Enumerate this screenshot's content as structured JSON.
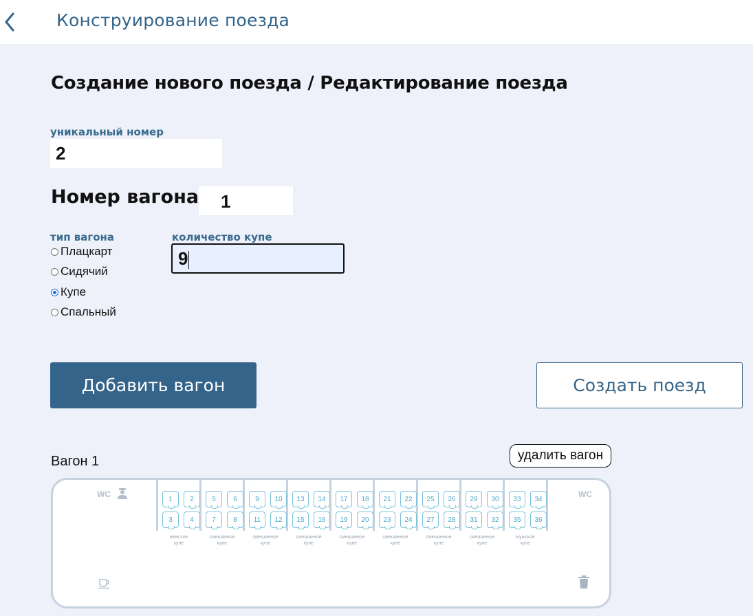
{
  "topbar": {
    "title": "Конструирование поезда"
  },
  "heading": "Создание нового поезда / Редактирование поезда",
  "unique_number": {
    "label": "уникальный номер",
    "value": "2"
  },
  "wagon_number": {
    "label": "Номер вагона:",
    "value": "1"
  },
  "wagon_type": {
    "label": "тип вагона",
    "options": [
      "Плацкарт",
      "Сидячий",
      "Купе",
      "Спальный"
    ],
    "selected": "Купе"
  },
  "compartments": {
    "label": "количество купе",
    "value": "9"
  },
  "buttons": {
    "add_car": "Добавить вагон",
    "create_train": "Создать поезд"
  },
  "car": {
    "title": "Вагон 1",
    "delete_label": "удалить вагон",
    "wc_left": "WC",
    "wc_right": "WC",
    "icons": [
      "conductor-icon",
      "cup-icon",
      "trash-icon"
    ],
    "compartments": [
      {
        "seats": [
          "1",
          "2",
          "3",
          "4"
        ],
        "label_top": "женское",
        "label_bottom": "купе"
      },
      {
        "seats": [
          "5",
          "6",
          "7",
          "8"
        ],
        "label_top": "смешанное",
        "label_bottom": "купе"
      },
      {
        "seats": [
          "9",
          "10",
          "11",
          "12"
        ],
        "label_top": "смешанное",
        "label_bottom": "купе"
      },
      {
        "seats": [
          "13",
          "14",
          "15",
          "16"
        ],
        "label_top": "смешанное",
        "label_bottom": "купе"
      },
      {
        "seats": [
          "17",
          "18",
          "19",
          "20"
        ],
        "label_top": "смешанное",
        "label_bottom": "купе"
      },
      {
        "seats": [
          "21",
          "22",
          "23",
          "24"
        ],
        "label_top": "смешанное",
        "label_bottom": "купе"
      },
      {
        "seats": [
          "25",
          "26",
          "27",
          "28"
        ],
        "label_top": "смешанное",
        "label_bottom": "купе"
      },
      {
        "seats": [
          "29",
          "30",
          "31",
          "32"
        ],
        "label_top": "смешанное",
        "label_bottom": "купе"
      },
      {
        "seats": [
          "33",
          "34",
          "35",
          "36"
        ],
        "label_top": "мужское",
        "label_bottom": "купе"
      }
    ]
  },
  "colors": {
    "primary": "#34648a",
    "background": "#eef1f9",
    "seat_border": "#7ac2dd",
    "radio_checked": "#1a73e8"
  }
}
